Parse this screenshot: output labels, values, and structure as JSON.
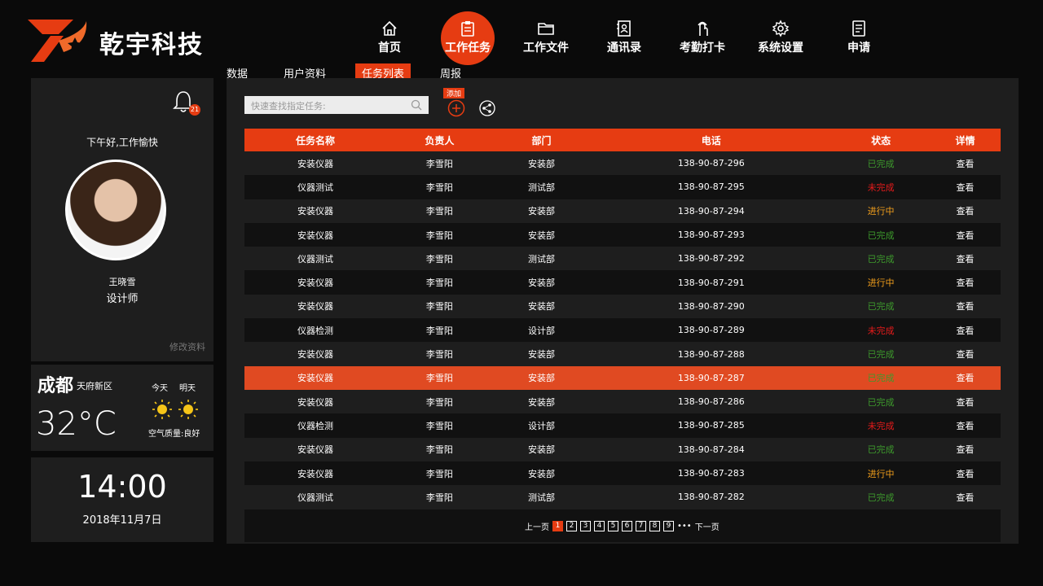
{
  "brand": {
    "name": "乾宇科技"
  },
  "nav": [
    {
      "label": "首页",
      "icon": "home-icon"
    },
    {
      "label": "工作任务",
      "icon": "clipboard-icon",
      "active": true
    },
    {
      "label": "工作文件",
      "icon": "folder-icon"
    },
    {
      "label": "通讯录",
      "icon": "contacts-icon"
    },
    {
      "label": "考勤打卡",
      "icon": "fingerprint-icon"
    },
    {
      "label": "系统设置",
      "icon": "gear-icon"
    },
    {
      "label": "申请",
      "icon": "document-icon"
    }
  ],
  "subtabs": [
    {
      "label": "数据"
    },
    {
      "label": "用户资料"
    },
    {
      "label": "任务列表",
      "active": true
    },
    {
      "label": "周报"
    }
  ],
  "profile": {
    "notifications": "21",
    "greeting": "下午好,工作愉快",
    "name": "王晓雪",
    "role": "设计师",
    "edit_label": "修改资料"
  },
  "weather": {
    "city": "成都",
    "district": "天府新区",
    "temperature": "32°C",
    "today": "今天",
    "tomorrow": "明天",
    "air_quality": "空气质量:良好"
  },
  "clock": {
    "time": "14:00",
    "date": "2018年11月7日"
  },
  "toolbar": {
    "search_placeholder": "快速查找指定任务:",
    "add_label": "添加"
  },
  "table": {
    "headers": [
      "任务名称",
      "负责人",
      "部门",
      "电话",
      "状态",
      "详情"
    ],
    "rows": [
      [
        "安装仪器",
        "李雪阳",
        "安装部",
        "138-90-87-296",
        "已完成",
        "查看"
      ],
      [
        "仪器测试",
        "李雪阳",
        "测试部",
        "138-90-87-295",
        "未完成",
        "查看"
      ],
      [
        "安装仪器",
        "李雪阳",
        "安装部",
        "138-90-87-294",
        "进行中",
        "查看"
      ],
      [
        "安装仪器",
        "李雪阳",
        "安装部",
        "138-90-87-293",
        "已完成",
        "查看"
      ],
      [
        "仪器测试",
        "李雪阳",
        "测试部",
        "138-90-87-292",
        "已完成",
        "查看"
      ],
      [
        "安装仪器",
        "李雪阳",
        "安装部",
        "138-90-87-291",
        "进行中",
        "查看"
      ],
      [
        "安装仪器",
        "李雪阳",
        "安装部",
        "138-90-87-290",
        "已完成",
        "查看"
      ],
      [
        "仪器检测",
        "李雪阳",
        "设计部",
        "138-90-87-289",
        "未完成",
        "查看"
      ],
      [
        "安装仪器",
        "李雪阳",
        "安装部",
        "138-90-87-288",
        "已完成",
        "查看"
      ],
      [
        "安装仪器",
        "李雪阳",
        "安装部",
        "138-90-87-287",
        "已完成",
        "查看"
      ],
      [
        "安装仪器",
        "李雪阳",
        "安装部",
        "138-90-87-286",
        "已完成",
        "查看"
      ],
      [
        "仪器检测",
        "李雪阳",
        "设计部",
        "138-90-87-285",
        "未完成",
        "查看"
      ],
      [
        "安装仪器",
        "李雪阳",
        "安装部",
        "138-90-87-284",
        "已完成",
        "查看"
      ],
      [
        "安装仪器",
        "李雪阳",
        "安装部",
        "138-90-87-283",
        "进行中",
        "查看"
      ],
      [
        "仪器测试",
        "李雪阳",
        "测试部",
        "138-90-87-282",
        "已完成",
        "查看"
      ]
    ],
    "selected_row": 9
  },
  "pager": {
    "prev": "上一页",
    "pages": [
      "1",
      "2",
      "3",
      "4",
      "5",
      "6",
      "7",
      "8",
      "9"
    ],
    "active": "1",
    "ellipsis": "•••",
    "next": "下一页"
  },
  "colors": {
    "accent": "#e63c12",
    "done": "#3d9a2c",
    "todo": "#e61b1b",
    "progress": "#f29f1c"
  }
}
